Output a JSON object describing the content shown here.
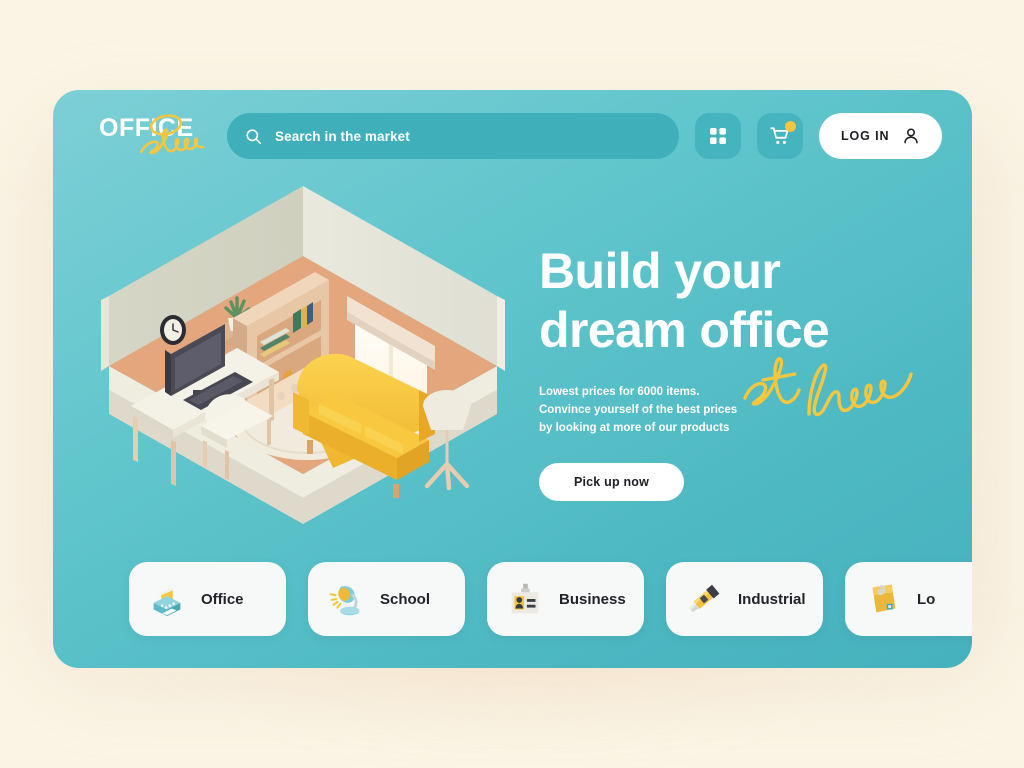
{
  "theme": {
    "page_background": "#faf4e4",
    "hero_gradient_from": "#7ecfd6",
    "hero_gradient_to": "#46b2bd",
    "accent_yellow": "#f5c63f",
    "search_fill": "#3fb0ba",
    "card_white": "#f7f9f8",
    "text_dark": "#1d1d24"
  },
  "topbar": {
    "logo": {
      "main": "OFFICE",
      "script": "store"
    },
    "search": {
      "placeholder": "Search in the market",
      "value": "",
      "icon": "search-icon"
    },
    "grid_button": {
      "icon": "grid-apps-icon",
      "label": ""
    },
    "cart_button": {
      "icon": "shopping-cart-icon",
      "badge": ""
    },
    "login_button": {
      "label": "LOG IN",
      "icon": "user-person-icon"
    }
  },
  "hero": {
    "headline_line1": "Build your",
    "headline_line2": "dream office",
    "script_overlay": "at home",
    "subcopy_line1": "Lowest prices for 6000 items.",
    "subcopy_line2": "Convince yourself of the best prices",
    "subcopy_line3": "by looking at more of our products",
    "cta_label": "Pick up now",
    "illustration_name": "isometric-home-office-room"
  },
  "categories": [
    {
      "label": "Office",
      "icon": "fax-printer-icon"
    },
    {
      "label": "School",
      "icon": "desk-lamp-icon"
    },
    {
      "label": "Business",
      "icon": "id-badge-icon"
    },
    {
      "label": "Industrial",
      "icon": "box-cutter-icon"
    },
    {
      "label": "Lo",
      "icon": "yellow-folder-envelope-icon"
    }
  ]
}
